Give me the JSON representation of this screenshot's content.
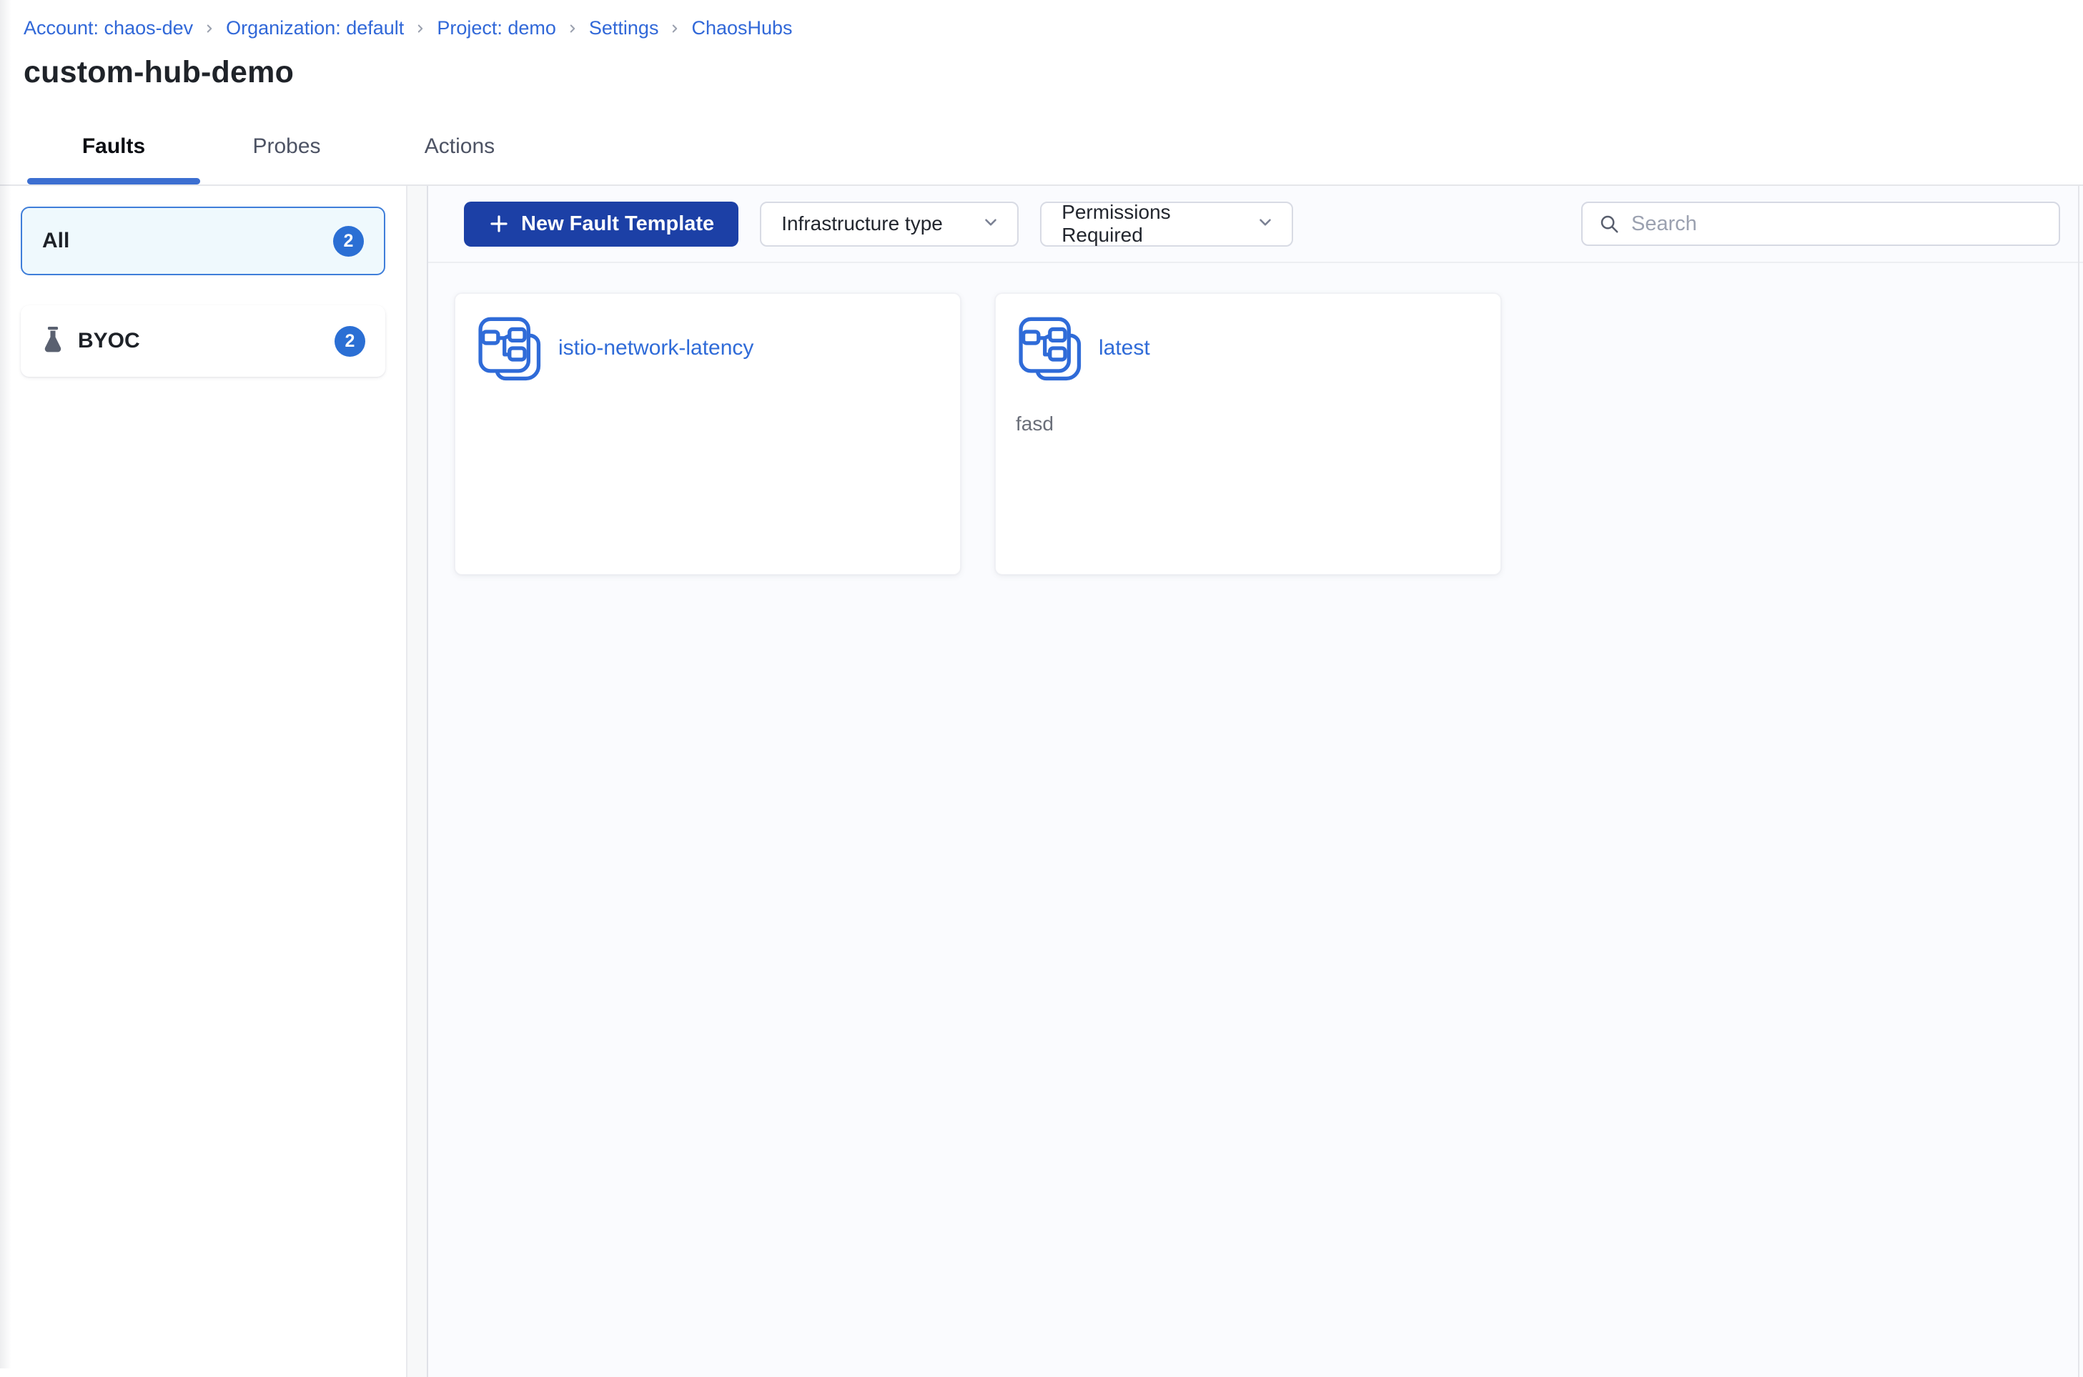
{
  "breadcrumb": {
    "items": [
      {
        "label": "Account: chaos-dev"
      },
      {
        "label": "Organization: default"
      },
      {
        "label": "Project: demo"
      },
      {
        "label": "Settings"
      },
      {
        "label": "ChaosHubs"
      }
    ]
  },
  "page": {
    "title": "custom-hub-demo"
  },
  "tabs": [
    {
      "label": "Faults",
      "active": true
    },
    {
      "label": "Probes",
      "active": false
    },
    {
      "label": "Actions",
      "active": false
    }
  ],
  "sidebar": {
    "filters": [
      {
        "label": "All",
        "count": "2",
        "selected": true
      },
      {
        "label": "BYOC",
        "count": "2",
        "icon": "flask-icon",
        "selected": false
      }
    ]
  },
  "toolbar": {
    "new_template_button": "New Fault Template",
    "infrastructure_filter": "Infrastructure type",
    "permissions_filter": "Permissions Required",
    "search_placeholder": "Search"
  },
  "cards": [
    {
      "title": "istio-network-latency",
      "description": "",
      "icon": "fault-template-icon"
    },
    {
      "title": "latest",
      "description": "fasd",
      "icon": "fault-template-icon"
    }
  ],
  "colors": {
    "link_blue": "#3168d8",
    "primary_button": "#1c40a6",
    "badge_blue": "#2b6fd4",
    "tab_underline": "#3c6fd1",
    "selected_filter_bg": "#eff9fd",
    "selected_filter_border": "#3f7ed9",
    "main_bg": "#fafbfe",
    "card_title_blue": "#2f6bd8"
  }
}
